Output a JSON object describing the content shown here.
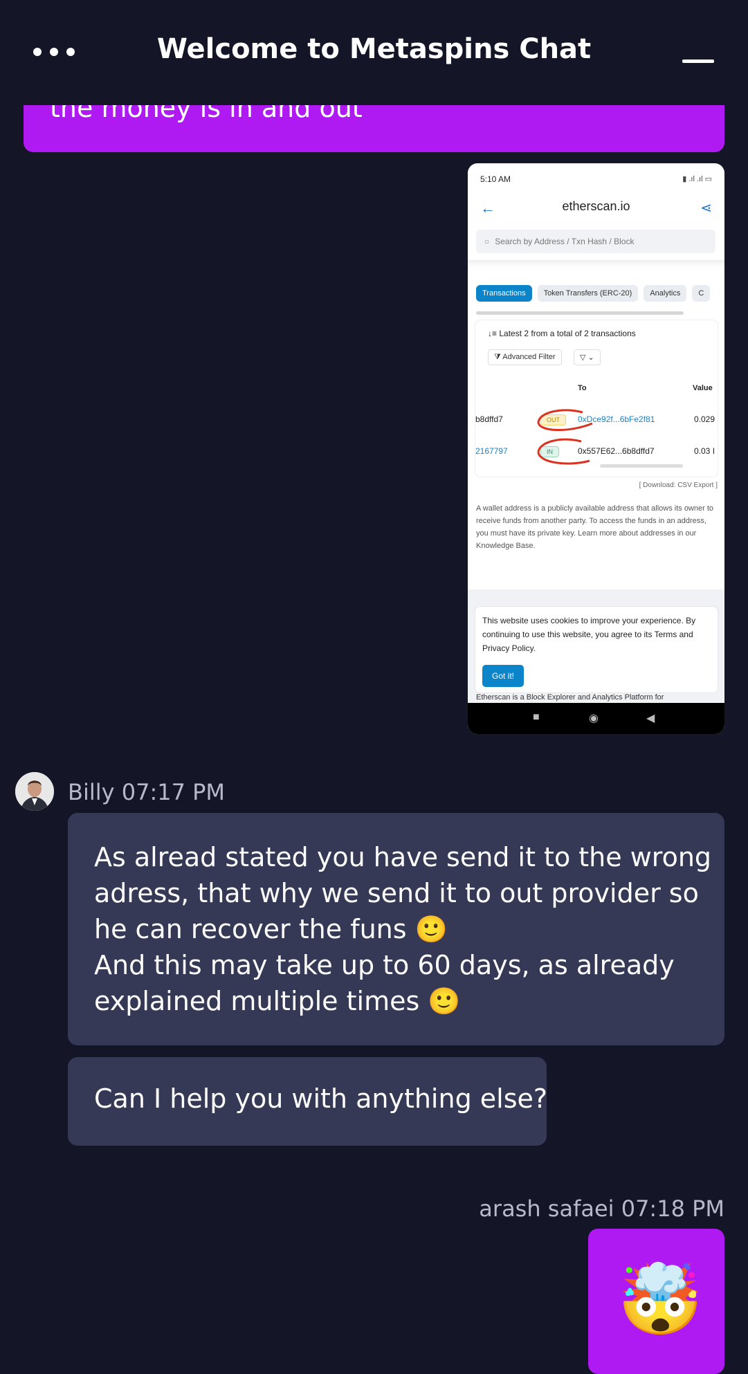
{
  "header": {
    "title": "Welcome to Metaspins Chat"
  },
  "messages": {
    "top_partial": "the money is in and out",
    "screenshot": {
      "status_time": "5:10 AM",
      "site": "etherscan.io",
      "search_placeholder": "Search by Address / Txn Hash / Block",
      "tabs": [
        "Transactions",
        "Token Transfers (ERC-20)",
        "Analytics",
        "C"
      ],
      "latest": "Latest 2 from a total of 2 transactions",
      "advanced_filter": "Advanced Filter",
      "col_to": "To",
      "col_value": "Value",
      "rows": [
        {
          "from": "b8dffd7",
          "badge": "OUT",
          "to": "0xDce92f...6bFe2f81",
          "value": "0.029"
        },
        {
          "from": "2167797",
          "badge": "IN",
          "to": "0x557E62...6b8dffd7",
          "value": "0.03 I"
        }
      ],
      "download": "[ Download: CSV Export ]",
      "info": "A wallet address is a publicly available address that allows its owner to receive funds from another party. To access the funds in an address, you must have its private key. Learn more about addresses in our Knowledge Base.",
      "cookie": "This website uses cookies to improve your experience. By continuing to use this website, you agree to its Terms and Privacy Policy.",
      "got_it": "Got it!",
      "footer": "Etherscan is a Block Explorer and Analytics Platform for"
    },
    "billy": {
      "name_time": "Billy 07:17 PM",
      "msg1_lines": [
        "As alread stated you have send it to the wrong",
        "adress, that why we send it to out provider so",
        "he can recover the funs 🙂",
        "And this may take up to 60 days, as already",
        "explained multiple times 🙂"
      ],
      "msg2": "Can I help you with anything else?"
    },
    "arash": {
      "name_time": "arash safaei 07:18 PM",
      "emoji": "🤯"
    }
  },
  "colors": {
    "background": "#141627",
    "user_bubble": "#b01af2",
    "agent_bubble": "#363955"
  }
}
